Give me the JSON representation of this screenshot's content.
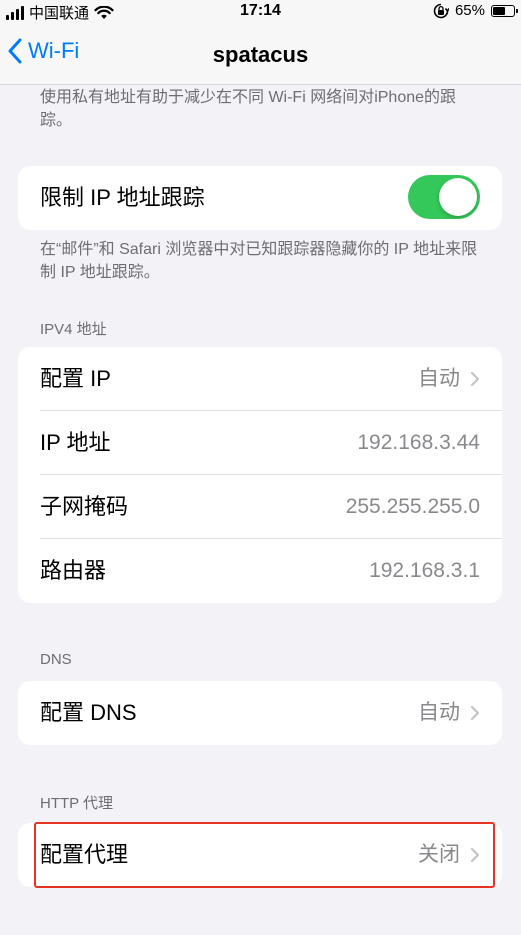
{
  "status_bar": {
    "carrier": "中国联通",
    "time": "17:14",
    "battery_text": "65%",
    "battery_level": 0.65,
    "icons": [
      "signal-bars-icon",
      "wifi-icon",
      "orientation-lock-icon",
      "battery-icon"
    ]
  },
  "nav": {
    "back_label": "Wi-Fi",
    "title": "spatacus"
  },
  "private_address_footnote": "使用私有地址有助于减少在不同 Wi-Fi 网络间对iPhone的跟踪。",
  "limit_ip_tracking": {
    "label": "限制 IP 地址跟踪",
    "enabled": true,
    "toggle_color": "#34c759",
    "footnote": "在“邮件”和 Safari 浏览器中对已知跟踪器隐藏你的 IP 地址来限制 IP 地址跟踪。"
  },
  "ipv4": {
    "header": "IPV4 地址",
    "rows": [
      {
        "label": "配置 IP",
        "value": "自动",
        "chevron": true
      },
      {
        "label": "IP 地址",
        "value": "192.168.3.44",
        "chevron": false
      },
      {
        "label": "子网掩码",
        "value": "255.255.255.0",
        "chevron": false
      },
      {
        "label": "路由器",
        "value": "192.168.3.1",
        "chevron": false
      }
    ]
  },
  "dns": {
    "header": "DNS",
    "row": {
      "label": "配置 DNS",
      "value": "自动",
      "chevron": true
    }
  },
  "http_proxy": {
    "header": "HTTP 代理",
    "row": {
      "label": "配置代理",
      "value": "关闭",
      "chevron": true
    },
    "highlight_color": "#e83323"
  },
  "colors": {
    "accent": "#007aff",
    "background": "#f2f2f7"
  }
}
